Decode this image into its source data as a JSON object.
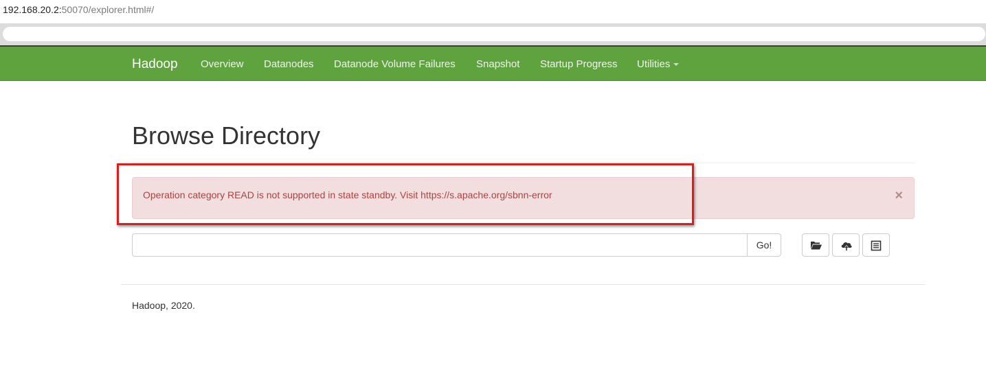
{
  "address_bar": {
    "host": "192.168.20.2:",
    "path": "50070/explorer.html#/"
  },
  "navbar": {
    "brand": "Hadoop",
    "items": [
      {
        "label": "Overview"
      },
      {
        "label": "Datanodes"
      },
      {
        "label": "Datanode Volume Failures"
      },
      {
        "label": "Snapshot"
      },
      {
        "label": "Startup Progress"
      },
      {
        "label": "Utilities"
      }
    ],
    "background_color": "#5fa33e"
  },
  "page": {
    "title": "Browse Directory"
  },
  "alert": {
    "message": "Operation category READ is not supported in state standby. Visit https://s.apache.org/sbnn-error",
    "close_symbol": "×",
    "background_color": "#f2dede",
    "text_color": "#a94442",
    "highlight_color": "#e01b1b"
  },
  "path_bar": {
    "value": "",
    "go_label": "Go!"
  },
  "toolbar": {
    "icons": [
      "folder-open-icon",
      "cloud-upload-icon",
      "list-alt-icon"
    ]
  },
  "footer": {
    "text": "Hadoop, 2020."
  }
}
